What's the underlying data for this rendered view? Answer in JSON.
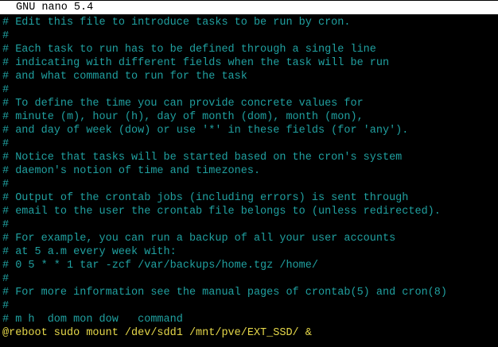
{
  "titlebar": {
    "title": "GNU nano 5.4"
  },
  "editor": {
    "lines": [
      {
        "text": "# Edit this file to introduce tasks to be run by cron.",
        "kind": "comment"
      },
      {
        "text": "#",
        "kind": "comment"
      },
      {
        "text": "# Each task to run has to be defined through a single line",
        "kind": "comment"
      },
      {
        "text": "# indicating with different fields when the task will be run",
        "kind": "comment"
      },
      {
        "text": "# and what command to run for the task",
        "kind": "comment"
      },
      {
        "text": "#",
        "kind": "comment"
      },
      {
        "text": "# To define the time you can provide concrete values for",
        "kind": "comment"
      },
      {
        "text": "# minute (m), hour (h), day of month (dom), month (mon),",
        "kind": "comment"
      },
      {
        "text": "# and day of week (dow) or use '*' in these fields (for 'any').",
        "kind": "comment"
      },
      {
        "text": "#",
        "kind": "comment"
      },
      {
        "text": "# Notice that tasks will be started based on the cron's system",
        "kind": "comment"
      },
      {
        "text": "# daemon's notion of time and timezones.",
        "kind": "comment"
      },
      {
        "text": "#",
        "kind": "comment"
      },
      {
        "text": "# Output of the crontab jobs (including errors) is sent through",
        "kind": "comment"
      },
      {
        "text": "# email to the user the crontab file belongs to (unless redirected).",
        "kind": "comment"
      },
      {
        "text": "#",
        "kind": "comment"
      },
      {
        "text": "# For example, you can run a backup of all your user accounts",
        "kind": "comment"
      },
      {
        "text": "# at 5 a.m every week with:",
        "kind": "comment"
      },
      {
        "text": "# 0 5 * * 1 tar -zcf /var/backups/home.tgz /home/",
        "kind": "comment"
      },
      {
        "text": "#",
        "kind": "comment"
      },
      {
        "text": "# For more information see the manual pages of crontab(5) and cron(8)",
        "kind": "comment"
      },
      {
        "text": "#",
        "kind": "comment"
      },
      {
        "text": "# m h  dom mon dow   command",
        "kind": "comment"
      },
      {
        "text": "@reboot sudo mount /dev/sdd1 /mnt/pve/EXT_SSD/ &",
        "kind": "command"
      }
    ]
  },
  "colors": {
    "comment": "#20a0a0",
    "command": "#e6d84a",
    "background": "#000000",
    "titlebar_bg": "#ffffff",
    "titlebar_fg": "#000000"
  }
}
